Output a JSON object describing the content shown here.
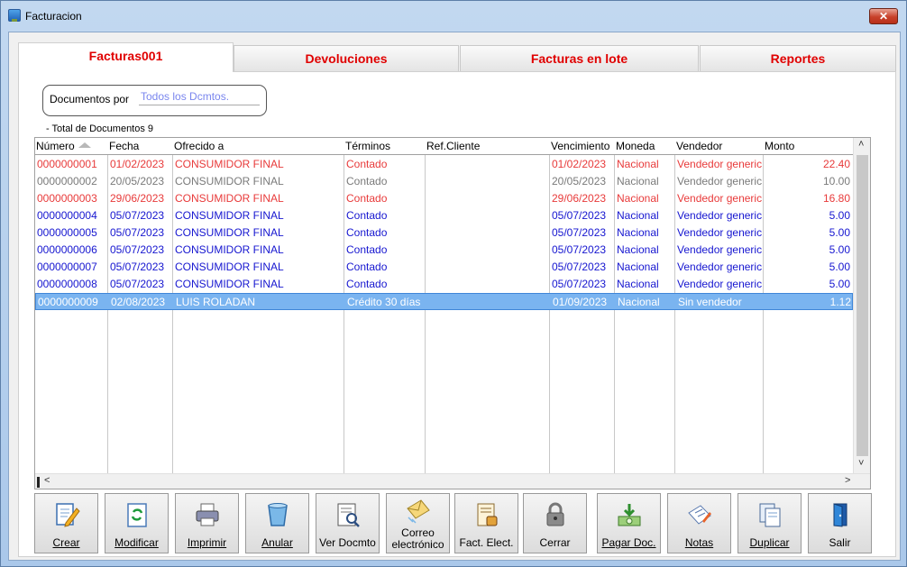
{
  "window": {
    "title": "Facturacion",
    "close_glyph": "✕"
  },
  "tabs": [
    {
      "label": "Facturas001",
      "active": true
    },
    {
      "label": "Devoluciones",
      "active": false
    },
    {
      "label": "Facturas en lote",
      "active": false
    },
    {
      "label": "Reportes",
      "active": false
    }
  ],
  "filter": {
    "label": "Documentos por",
    "value": "Todos los Dcmtos."
  },
  "total_label": "-    Total de Documentos 9",
  "grid": {
    "columns": [
      "Número",
      "Fecha",
      "Ofrecido a",
      "Términos",
      "Ref.Cliente",
      "Vencimiento",
      "Moneda",
      "Vendedor",
      "Monto"
    ],
    "sorted_column": "Número",
    "rows": [
      {
        "numero": "0000000001",
        "fecha": "01/02/2023",
        "ofrecido": "CONSUMIDOR FINAL",
        "terminos": "Contado",
        "ref": "",
        "vencimiento": "01/02/2023",
        "moneda": "Nacional",
        "vendedor": "Vendedor generic",
        "monto": "22.40",
        "color": "#e83a3a"
      },
      {
        "numero": "0000000002",
        "fecha": "20/05/2023",
        "ofrecido": "CONSUMIDOR FINAL",
        "terminos": "Contado",
        "ref": "",
        "vencimiento": "20/05/2023",
        "moneda": "Nacional",
        "vendedor": "Vendedor generic",
        "monto": "10.00",
        "color": "#7a7a7a"
      },
      {
        "numero": "0000000003",
        "fecha": "29/06/2023",
        "ofrecido": "CONSUMIDOR FINAL",
        "terminos": "Contado",
        "ref": "",
        "vencimiento": "29/06/2023",
        "moneda": "Nacional",
        "vendedor": "Vendedor generic",
        "monto": "16.80",
        "color": "#e83a3a"
      },
      {
        "numero": "0000000004",
        "fecha": "05/07/2023",
        "ofrecido": "CONSUMIDOR FINAL",
        "terminos": "Contado",
        "ref": "",
        "vencimiento": "05/07/2023",
        "moneda": "Nacional",
        "vendedor": "Vendedor generic",
        "monto": "5.00",
        "color": "#1616d0"
      },
      {
        "numero": "0000000005",
        "fecha": "05/07/2023",
        "ofrecido": "CONSUMIDOR FINAL",
        "terminos": "Contado",
        "ref": "",
        "vencimiento": "05/07/2023",
        "moneda": "Nacional",
        "vendedor": "Vendedor generic",
        "monto": "5.00",
        "color": "#1616d0"
      },
      {
        "numero": "0000000006",
        "fecha": "05/07/2023",
        "ofrecido": "CONSUMIDOR FINAL",
        "terminos": "Contado",
        "ref": "",
        "vencimiento": "05/07/2023",
        "moneda": "Nacional",
        "vendedor": "Vendedor generic",
        "monto": "5.00",
        "color": "#1616d0"
      },
      {
        "numero": "0000000007",
        "fecha": "05/07/2023",
        "ofrecido": "CONSUMIDOR FINAL",
        "terminos": "Contado",
        "ref": "",
        "vencimiento": "05/07/2023",
        "moneda": "Nacional",
        "vendedor": "Vendedor generic",
        "monto": "5.00",
        "color": "#1616d0"
      },
      {
        "numero": "0000000008",
        "fecha": "05/07/2023",
        "ofrecido": "CONSUMIDOR FINAL",
        "terminos": "Contado",
        "ref": "",
        "vencimiento": "05/07/2023",
        "moneda": "Nacional",
        "vendedor": "Vendedor generic",
        "monto": "5.00",
        "color": "#1616d0"
      },
      {
        "numero": "0000000009",
        "fecha": "02/08/2023",
        "ofrecido": "LUIS ROLADAN",
        "terminos": "Crédito 30 días",
        "ref": "",
        "vencimiento": "01/09/2023",
        "moneda": "Nacional",
        "vendedor": "Sin vendedor",
        "monto": "1.12",
        "color": "#ffffff",
        "selected": true
      }
    ]
  },
  "scroll": {
    "up": "˄",
    "down": "˅",
    "left": "<",
    "right": ">"
  },
  "toolbar": [
    {
      "label": "Crear",
      "icon": "create-icon"
    },
    {
      "label": "Modificar",
      "icon": "modify-icon"
    },
    {
      "label": "Imprimir",
      "icon": "printer-icon"
    },
    {
      "label": "Anular",
      "icon": "void-bin-icon"
    },
    {
      "label": "Ver Docmto",
      "icon": "view-document-icon"
    },
    {
      "label": "Correo electrónico",
      "icon": "email-icon"
    },
    {
      "label": "Fact. Elect.",
      "icon": "electronic-invoice-icon"
    },
    {
      "label": "Cerrar",
      "icon": "lock-icon"
    },
    {
      "label": "Pagar Doc.",
      "icon": "pay-money-icon"
    },
    {
      "label": "Notas",
      "icon": "notes-icon"
    },
    {
      "label": "Duplicar",
      "icon": "duplicate-icon"
    },
    {
      "label": "Salir",
      "icon": "exit-door-icon"
    }
  ]
}
